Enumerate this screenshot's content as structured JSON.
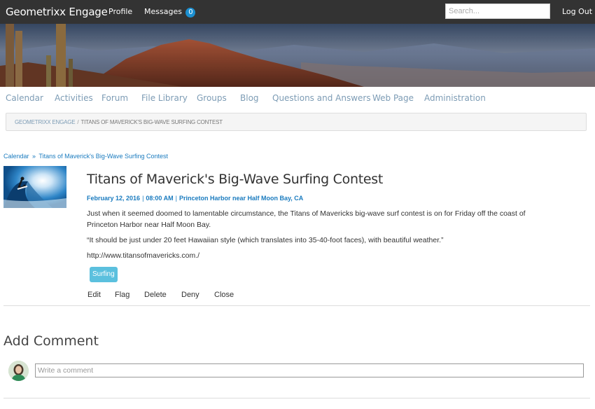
{
  "header": {
    "brand": "Geometrixx Engage",
    "profile_label": "Profile",
    "messages_label": "Messages",
    "messages_count": "0",
    "search_placeholder": "Search...",
    "logout_label": "Log Out"
  },
  "nav": {
    "items": [
      "Calendar",
      "Activities",
      "Forum",
      "File Library",
      "Groups",
      "Blog",
      "Questions and Answers",
      "Web Page",
      "Administration"
    ]
  },
  "breadcrumb": {
    "home": "GEOMETRIXX ENGAGE",
    "separator": "/",
    "current": "TITANS OF MAVERICK'S BIG-WAVE SURFING CONTEST"
  },
  "trail": {
    "parent": "Calendar",
    "separator": "»",
    "current": "Titans of Maverick's Big-Wave Surfing Contest"
  },
  "event": {
    "title": "Titans of Maverick's Big-Wave Surfing Contest",
    "date": "February 12, 2016",
    "time": "08:00 AM",
    "location": "Princeton Harbor near Half Moon Bay, CA",
    "meta_separator": "|",
    "description_1": "Just when it seemed doomed to lamentable circumstance, the Titans of Mavericks big-wave surf contest is on for Friday off the coast of Princeton Harbor near Half Moon Bay.",
    "description_2": "“It should be just under 20 feet Hawaiian style (which translates into 35-40-foot faces), with beautiful weather.”",
    "url": "http://www.titansofmavericks.com./",
    "tag": "Surfing"
  },
  "actions": {
    "edit": "Edit",
    "flag": "Flag",
    "delete": "Delete",
    "deny": "Deny",
    "close": "Close"
  },
  "comments": {
    "heading": "Add Comment",
    "placeholder": "Write a comment"
  },
  "colors": {
    "topbar": "#333333",
    "nav_link": "#7d9cb5",
    "link_blue": "#1a7bbf",
    "badge": "#1b8fd0",
    "tag": "#5bc0de"
  },
  "icons": {
    "banner": "desert-mountain-image",
    "thumbnail": "surfer-image",
    "avatar": "user-avatar-image"
  }
}
